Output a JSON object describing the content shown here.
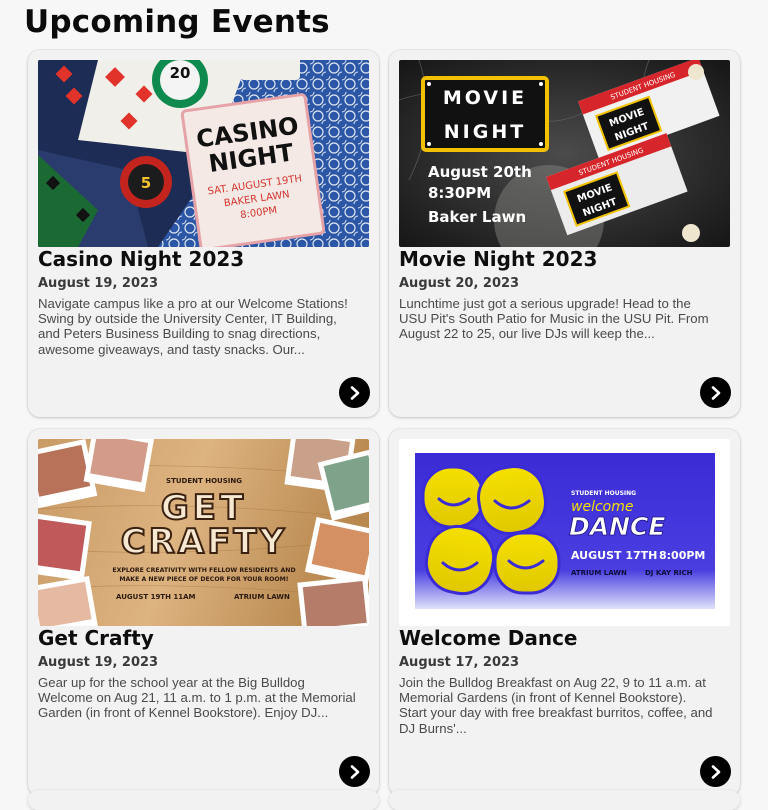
{
  "page": {
    "title": "Upcoming Events"
  },
  "events": [
    {
      "title": "Casino Night 2023",
      "date": "August 19, 2023",
      "description": "Navigate campus like a pro at our Welcome Stations! Swing by outside the University Center, IT Building, and Peters Business Building to snag directions, awesome giveaways, and tasty snacks. Our...",
      "image": {
        "heading_1": "CASINO",
        "heading_2": "NIGHT",
        "line_1": "SAT. AUGUST 19TH",
        "line_2": "BAKER LAWN",
        "line_3": "8:00PM",
        "chip_1": "20",
        "chip_2": "5"
      }
    },
    {
      "title": "Movie Night 2023",
      "date": "August 20, 2023",
      "description": "Lunchtime just got a serious upgrade! Head to the USU Pit's South Patio for Music in the USU Pit. From August 22 to 25, our live DJs will keep the...",
      "image": {
        "sign_1": "MOVIE",
        "sign_2": "NIGHT",
        "line_1": "August 20th",
        "line_2": "8:30PM",
        "line_3": "Baker Lawn",
        "ticket_header": "STUDENT HOUSING",
        "ticket_title_1": "MOVIE",
        "ticket_title_2": "NIGHT"
      }
    },
    {
      "title": "Get Crafty",
      "date": "August 19, 2023",
      "description": "Gear up for the school year at the Big Bulldog Welcome on Aug 21, 11 a.m. to 1 p.m. at the Memorial Garden (in front of Kennel Bookstore). Enjoy DJ...",
      "image": {
        "org": "STUDENT HOUSING",
        "heading_1": "GET",
        "heading_2": "CRAFTY",
        "sub_1": "EXPLORE CREATIVITY WITH FELLOW RESIDENTS AND",
        "sub_2": "MAKE A NEW PIECE OF DECOR FOR YOUR ROOM!",
        "when": "AUGUST 19TH  11AM",
        "where": "ATRIUM LAWN"
      }
    },
    {
      "title": "Welcome Dance",
      "date": "August 17, 2023",
      "description": "Join the Bulldog Breakfast on Aug 22, 9 to 11 a.m. at Memorial Gardens (in front of Kennel Bookstore). Start your day with free breakfast burritos, coffee, and DJ Burns'...",
      "image": {
        "org": "STUDENT HOUSING",
        "script": "welcome",
        "heading": "DANCE",
        "date": "AUGUST 17TH",
        "time": "8:00PM",
        "place": "ATRIUM LAWN",
        "dj": "DJ KAY RICH"
      }
    }
  ],
  "colors": {
    "background": "#f7f7f8",
    "card": "#f2f2f3",
    "button": "#000000",
    "dance_blue": "#3b2bd6",
    "dance_yellow": "#f5e000"
  },
  "icons": {
    "card_action": "chevron-right-icon"
  }
}
